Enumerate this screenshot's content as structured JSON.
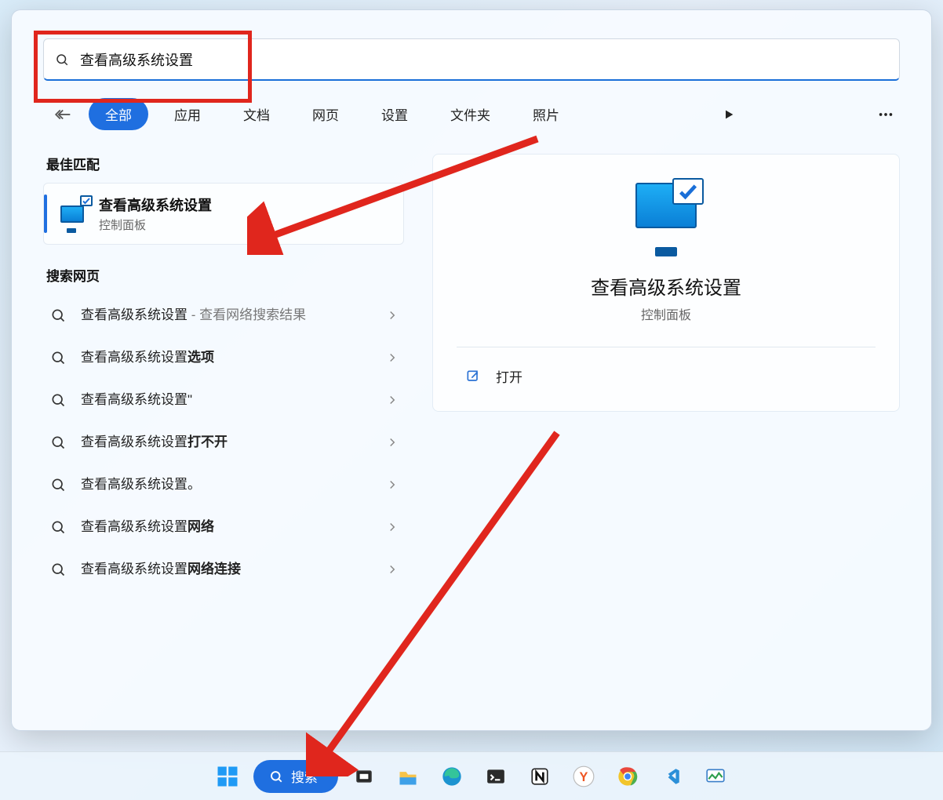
{
  "search": {
    "value": "查看高级系统设置",
    "placeholder": ""
  },
  "filters": {
    "all": "全部",
    "apps": "应用",
    "docs": "文档",
    "web": "网页",
    "settings": "设置",
    "folders": "文件夹",
    "photos": "照片"
  },
  "left": {
    "best_header": "最佳匹配",
    "best_title": "查看高级系统设置",
    "best_sub": "控制面板",
    "web_header": "搜索网页",
    "web_items": [
      {
        "base": "查看高级系统设置",
        "suffix": "",
        "note": " - 查看网络搜索结果"
      },
      {
        "base": "查看高级系统设置",
        "suffix": "选项",
        "note": ""
      },
      {
        "base": "查看高级系统设置\"",
        "suffix": "",
        "note": ""
      },
      {
        "base": "查看高级系统设置",
        "suffix": "打不开",
        "note": ""
      },
      {
        "base": "查看高级系统设置。",
        "suffix": "",
        "note": ""
      },
      {
        "base": "查看高级系统设置",
        "suffix": "网络",
        "note": ""
      },
      {
        "base": "查看高级系统设置",
        "suffix": "网络连接",
        "note": ""
      }
    ]
  },
  "right": {
    "title": "查看高级系统设置",
    "sub": "控制面板",
    "open": "打开"
  },
  "taskbar": {
    "search_label": "搜索"
  },
  "colors": {
    "accent": "#1f6fe0",
    "annotation": "#e0261d"
  }
}
